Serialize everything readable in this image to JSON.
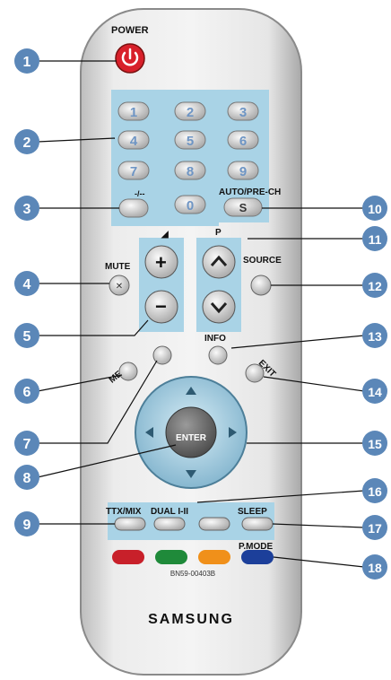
{
  "labels": {
    "power": "POWER",
    "auto_prech": "AUTO/PRE-CH",
    "mute": "MUTE",
    "p": "P",
    "source": "SOURCE",
    "menu": "MENU",
    "info": "INFO",
    "exit": "EXIT",
    "enter": "ENTER",
    "ttx_mix": "TTX/MIX",
    "dual": "DUAL I-II",
    "sleep": "SLEEP",
    "p_mode": "P.MODE",
    "model": "BN59-00403B",
    "brand": "SAMSUNG"
  },
  "number_keys": [
    "1",
    "2",
    "3",
    "4",
    "5",
    "6",
    "7",
    "8",
    "9",
    "0"
  ],
  "callouts": [
    "1",
    "2",
    "3",
    "4",
    "5",
    "6",
    "7",
    "8",
    "9",
    "10",
    "11",
    "12",
    "13",
    "14",
    "15",
    "16",
    "17",
    "18"
  ],
  "colors": {
    "callout_blue": "#5b87b8",
    "panel_blue": "#a9d3e6",
    "power_red": "#d8202a",
    "key_red": "#c8202a",
    "key_green": "#1f8a3a",
    "key_yellow": "#f0901a",
    "key_blue": "#1c3f9a",
    "body": "#e4e4e4"
  }
}
